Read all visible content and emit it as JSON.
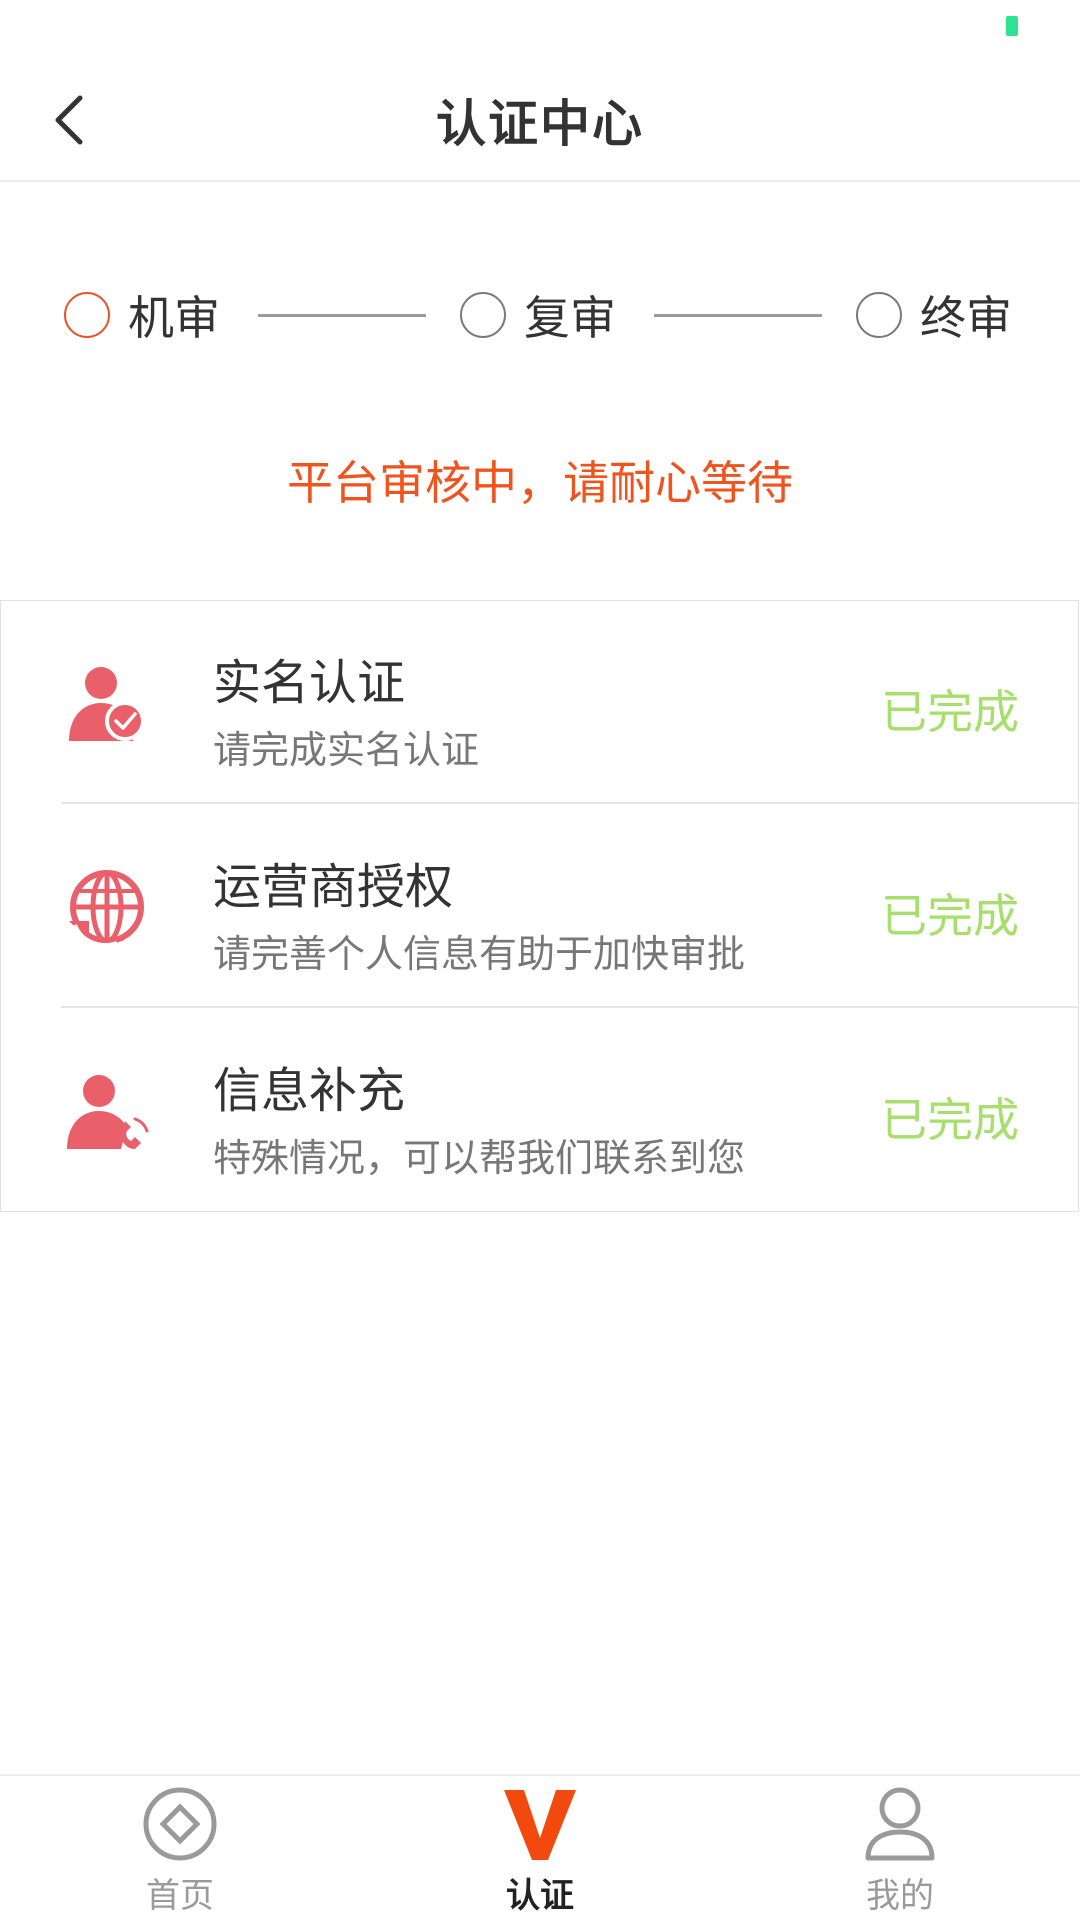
{
  "header": {
    "title": "认证中心",
    "back_icon": "chevron-left-icon"
  },
  "steps": [
    {
      "label": "机审",
      "active": true
    },
    {
      "label": "复审",
      "active": false
    },
    {
      "label": "终审",
      "active": false
    }
  ],
  "review_status": "平台审核中，请耐心等待",
  "cards": [
    {
      "icon": "user-check-icon",
      "title": "实名认证",
      "subtitle": "请完成实名认证",
      "status": "已完成"
    },
    {
      "icon": "globe-refresh-icon",
      "title": "运营商授权",
      "subtitle": "请完善个人信息有助于加快审批",
      "status": "已完成"
    },
    {
      "icon": "user-phone-icon",
      "title": "信息补充",
      "subtitle": "特殊情况，可以帮我们联系到您",
      "status": "已完成"
    }
  ],
  "tabs": [
    {
      "label": "首页",
      "icon": "home-diamond-icon",
      "active": false
    },
    {
      "label": "认证",
      "icon": "v-logo-icon",
      "active": true
    },
    {
      "label": "我的",
      "icon": "person-icon",
      "active": false
    }
  ],
  "colors": {
    "accent": "#f0541e",
    "active_step": "#e8542a",
    "completed": "#a6df6b",
    "icon": "#e9606a",
    "status_indicator": "#2de391"
  }
}
